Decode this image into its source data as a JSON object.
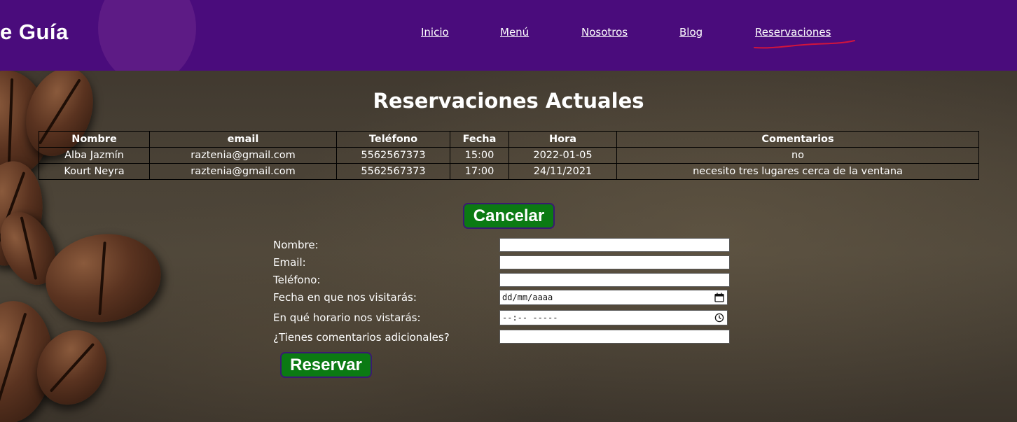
{
  "header": {
    "brand": "e Guía",
    "nav": [
      "Inicio",
      "Menú",
      "Nosotros",
      "Blog",
      "Reservaciones"
    ]
  },
  "title": "Reservaciones Actuales",
  "table": {
    "headers": [
      "Nombre",
      "email",
      "Teléfono",
      "Fecha",
      "Hora",
      "Comentarios"
    ],
    "rows": [
      [
        "Alba Jazmín",
        "raztenia@gmail.com",
        "5562567373",
        "15:00",
        "2022-01-05",
        "no"
      ],
      [
        "Kourt Neyra",
        "raztenia@gmail.com",
        "5562567373",
        "17:00",
        "24/11/2021",
        "necesito tres lugares cerca de la ventana"
      ]
    ]
  },
  "cancel_label": "Cancelar",
  "form": {
    "labels": {
      "nombre": "Nombre:",
      "email": "Email:",
      "telefono": "Teléfono:",
      "fecha": "Fecha en que nos visitarás:",
      "hora": "En qué horario nos vistarás:",
      "comentarios": "¿Tienes comentarios adicionales?"
    },
    "date_placeholder": "dd/mm/aaaa",
    "time_placeholder": "--:-- -----",
    "submit_label": "Reservar"
  },
  "colors": {
    "header_bg": "#4a0c7c",
    "button_bg": "#0b7a13",
    "annotation": "#d2143c"
  }
}
